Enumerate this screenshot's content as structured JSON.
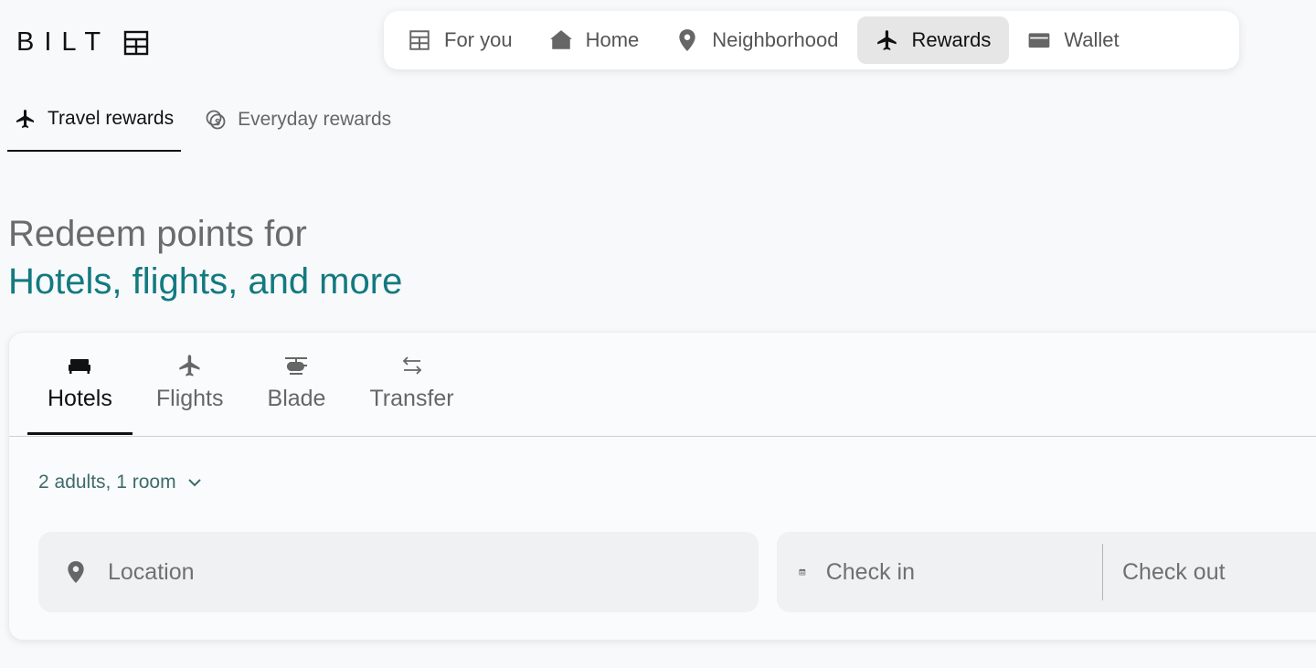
{
  "brand": {
    "name": "BILT"
  },
  "nav": {
    "items": [
      {
        "label": "For you",
        "icon": "building-grid-icon"
      },
      {
        "label": "Home",
        "icon": "house-icon"
      },
      {
        "label": "Neighborhood",
        "icon": "map-pin-icon"
      },
      {
        "label": "Rewards",
        "icon": "airplane-icon",
        "active": true
      },
      {
        "label": "Wallet",
        "icon": "wallet-icon"
      }
    ]
  },
  "subtabs": [
    {
      "label": "Travel rewards",
      "icon": "airplane-icon",
      "active": true
    },
    {
      "label": "Everyday rewards",
      "icon": "coins-icon"
    }
  ],
  "hero": {
    "line1": "Redeem points for",
    "line2": "Hotels, flights, and more"
  },
  "booking": {
    "tabs": [
      {
        "label": "Hotels",
        "icon": "bed-icon",
        "active": true
      },
      {
        "label": "Flights",
        "icon": "airplane-icon"
      },
      {
        "label": "Blade",
        "icon": "helicopter-icon"
      },
      {
        "label": "Transfer",
        "icon": "transfer-arrows-icon"
      }
    ],
    "guests": "2 adults, 1 room",
    "location_placeholder": "Location",
    "checkin_placeholder": "Check in",
    "checkout_placeholder": "Check out"
  },
  "colors": {
    "accent_teal": "#127a80",
    "guests_text": "#3d6b69",
    "active_tab_bg": "#e6e6e6"
  }
}
